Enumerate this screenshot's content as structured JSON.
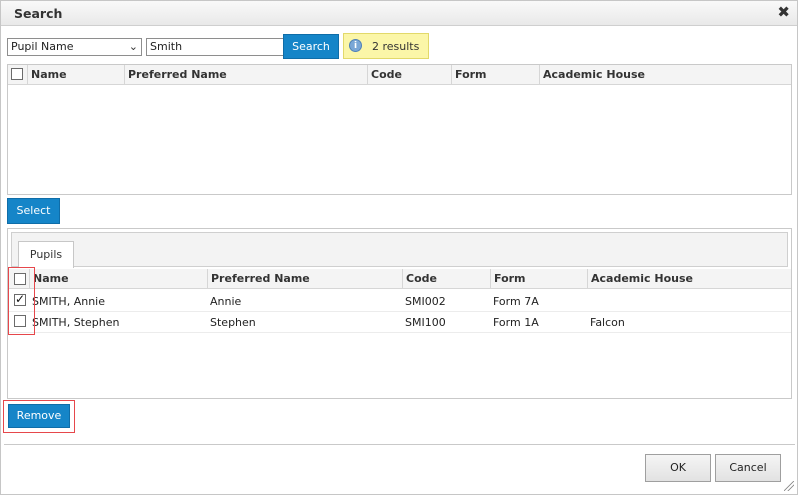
{
  "dialog": {
    "title": "Search",
    "close_symbol": "✖"
  },
  "search": {
    "type_selected": "Pupil Name",
    "query_value": "Smith",
    "search_label": "Search",
    "results_text": "2 results",
    "info_icon": "i"
  },
  "results_grid": {
    "columns": [
      "Name",
      "Preferred Name",
      "Code",
      "Form",
      "Academic House"
    ]
  },
  "select_label": "Select",
  "pupils": {
    "tab_label": "Pupils",
    "columns": [
      "Name",
      "Preferred Name",
      "Code",
      "Form",
      "Academic House"
    ],
    "rows": [
      {
        "checked": true,
        "name": "SMITH, Annie",
        "preferred": "Annie",
        "code": "SMI002",
        "form": "Form 7A",
        "house": ""
      },
      {
        "checked": false,
        "name": "SMITH, Stephen",
        "preferred": "Stephen",
        "code": "SMI100",
        "form": "Form 1A",
        "house": "Falcon"
      }
    ]
  },
  "remove_label": "Remove",
  "footer": {
    "ok_label": "OK",
    "cancel_label": "Cancel"
  },
  "colors": {
    "accent_button": "#1585c8",
    "result_badge": "#fbf6a8",
    "highlight_outline": "#e6474b"
  }
}
